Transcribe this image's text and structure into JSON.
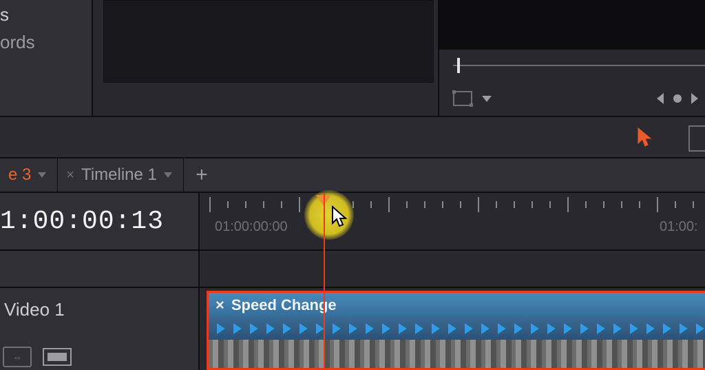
{
  "top_left": {
    "frag1": "s",
    "frag2": "ords"
  },
  "tabs": {
    "active": {
      "label_fragment": "e 3"
    },
    "second": {
      "label": "Timeline 1"
    }
  },
  "timecode": "1:00:00:13",
  "ruler": {
    "label_start": "01:00:00:00",
    "label_next_fragment": "01:00:"
  },
  "track": {
    "name": "Video 1"
  },
  "clip": {
    "title": "Speed Change",
    "close_glyph": "×"
  },
  "icons": {
    "plus": "+",
    "close": "×",
    "toggle_glyph": "⇔"
  }
}
